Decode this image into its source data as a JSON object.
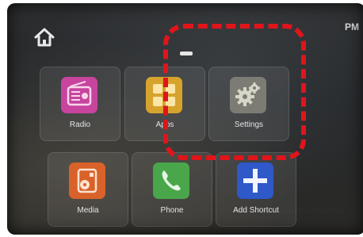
{
  "status": {
    "clock": "PM"
  },
  "icons": {
    "home": "home-icon"
  },
  "apps": [
    {
      "label": "Radio",
      "icon": "radio-icon",
      "color": "#c8449e"
    },
    {
      "label": "Apps",
      "icon": "apps-icon",
      "color": "#d6a42c"
    },
    {
      "label": "Settings",
      "icon": "gear-icon",
      "color": "#7c7c74"
    },
    {
      "label": "Media",
      "icon": "media-icon",
      "color": "#d8622a"
    },
    {
      "label": "Phone",
      "icon": "phone-icon",
      "color": "#4aa64a"
    },
    {
      "label": "Add Shortcut",
      "icon": "plus-icon",
      "color": "#2f58c8"
    }
  ],
  "annotation": {
    "highlight_color": "#e0151b",
    "target": "Settings"
  }
}
